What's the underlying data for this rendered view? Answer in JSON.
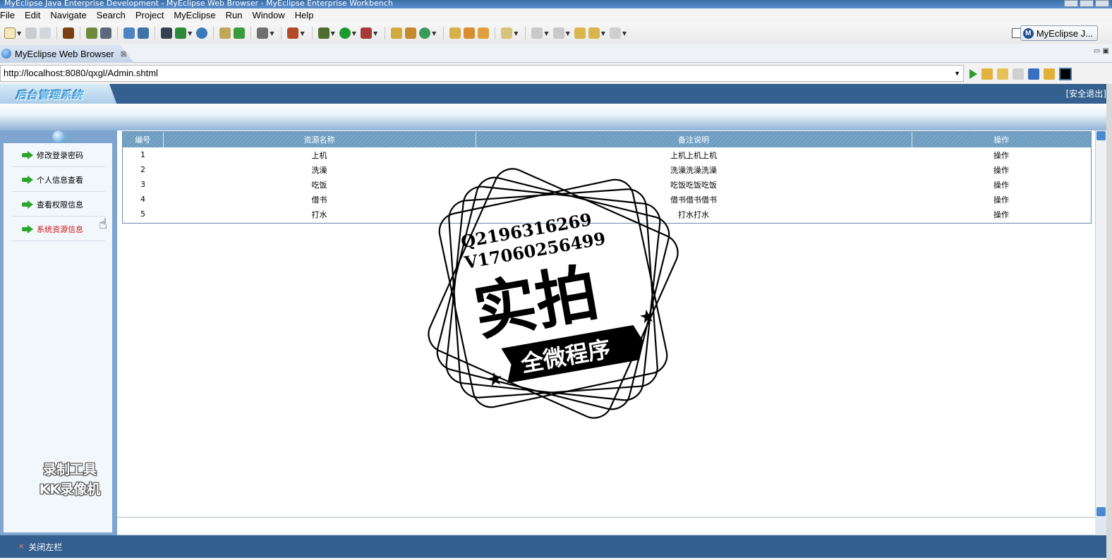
{
  "window": {
    "title": "MyEclipse Java Enterprise Development - MyEclipse Web Browser - MyEclipse Enterprise Workbench"
  },
  "menu": [
    "File",
    "Edit",
    "Navigate",
    "Search",
    "Project",
    "MyEclipse",
    "Run",
    "Window",
    "Help"
  ],
  "perspective": {
    "label": "MyEclipse J..."
  },
  "editor_tab": {
    "label": "MyEclipse Web Browser",
    "close": "⊠"
  },
  "browser": {
    "url": "http://localhost:8080/qxgl/Admin.shtml"
  },
  "site": {
    "logo": "后台管理系统",
    "logout": "[安全退出]",
    "sidebar": [
      {
        "label": "修改登录密码",
        "active": false
      },
      {
        "label": "个人信息查看",
        "active": false
      },
      {
        "label": "查看权限信息",
        "active": false
      },
      {
        "label": "系统资源信息",
        "active": true
      }
    ],
    "table": {
      "headers": [
        "编号",
        "资源名称",
        "备注说明",
        "操作"
      ],
      "rows": [
        [
          "1",
          "上机",
          "上机上机上机",
          "操作"
        ],
        [
          "2",
          "洗澡",
          "洗澡洗澡洗澡",
          "操作"
        ],
        [
          "3",
          "吃饭",
          "吃饭吃饭吃饭",
          "操作"
        ],
        [
          "4",
          "借书",
          "借书借书借书",
          "操作"
        ],
        [
          "5",
          "打水",
          "打水打水",
          "操作"
        ]
      ]
    },
    "status_bar": "关闭左栏"
  },
  "watermark": {
    "line1": "Q2196316269",
    "line2": "V17060256499",
    "big": "实拍",
    "banner": "全微程序"
  },
  "recorder_mark": {
    "line1": "录制工具",
    "line2": "KK录像机"
  }
}
